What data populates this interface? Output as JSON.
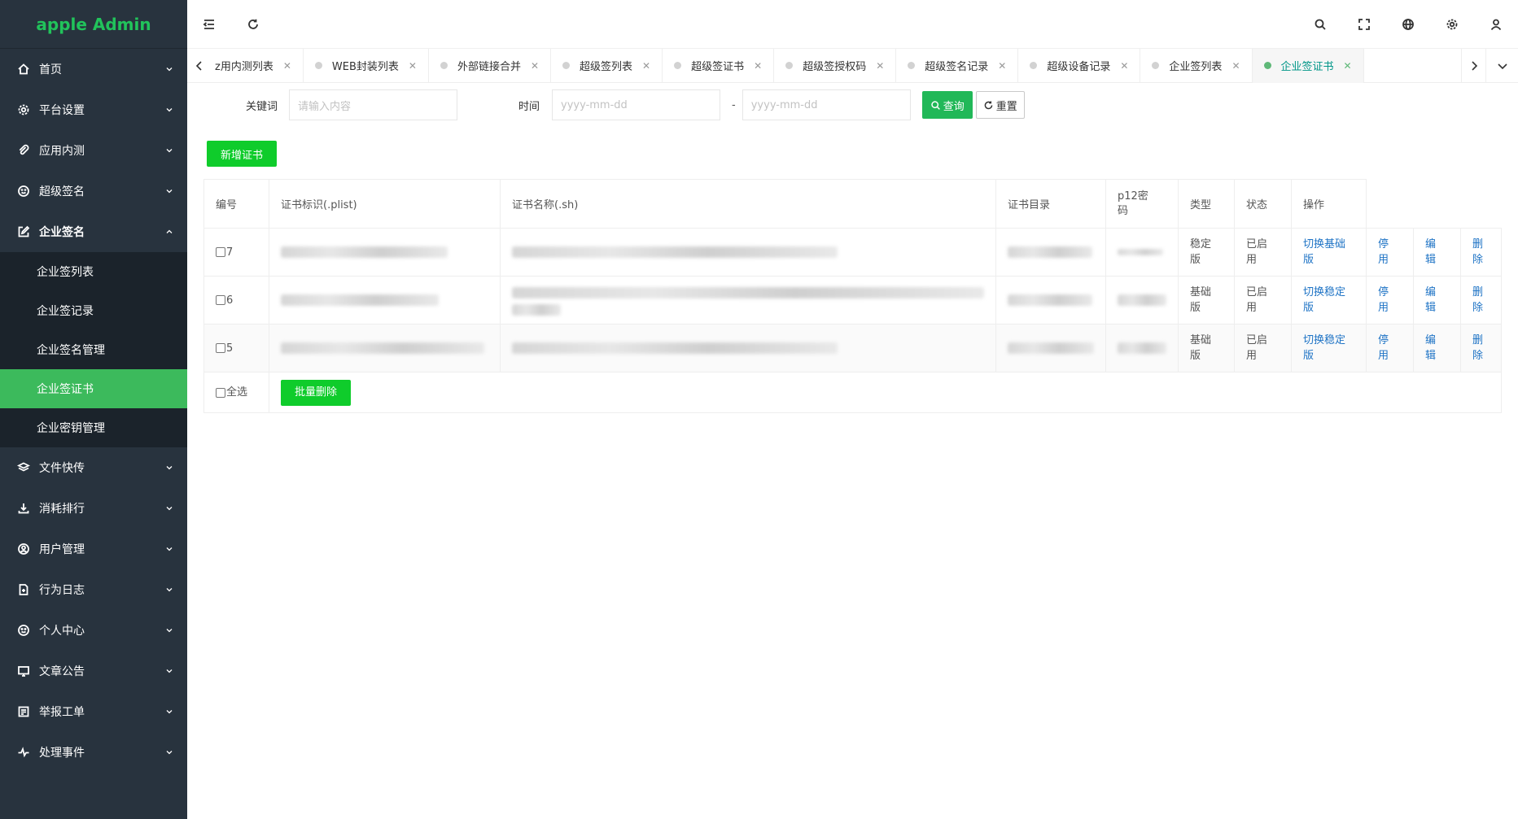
{
  "app": {
    "title": "apple Admin",
    "brand_color": "#21c35b",
    "accent": "#3cba5c"
  },
  "sidebar": {
    "items": [
      {
        "label": "首页",
        "icon": "home-icon"
      },
      {
        "label": "平台设置",
        "icon": "gear-icon"
      },
      {
        "label": "应用内测",
        "icon": "paperclip-icon"
      },
      {
        "label": "超级签名",
        "icon": "smile-icon"
      },
      {
        "label": "企业签名",
        "icon": "edit-icon",
        "open": true
      },
      {
        "label": "文件快传",
        "icon": "layers-icon"
      },
      {
        "label": "消耗排行",
        "icon": "download-icon"
      },
      {
        "label": "用户管理",
        "icon": "user-circle-icon"
      },
      {
        "label": "行为日志",
        "icon": "file-icon"
      },
      {
        "label": "个人中心",
        "icon": "face-icon"
      },
      {
        "label": "文章公告",
        "icon": "monitor-icon"
      },
      {
        "label": "举报工单",
        "icon": "report-icon"
      },
      {
        "label": "处理事件",
        "icon": "pulse-icon"
      }
    ],
    "submenu": [
      {
        "label": "企业签列表"
      },
      {
        "label": "企业签记录"
      },
      {
        "label": "企业签名管理"
      },
      {
        "label": "企业签证书",
        "active": true
      },
      {
        "label": "企业密钥管理"
      }
    ]
  },
  "header": {
    "icons": [
      "menu-fold-icon",
      "refresh-icon",
      "search-icon",
      "fullscreen-icon",
      "globe-icon",
      "settings-icon",
      "user-icon"
    ]
  },
  "tabs": [
    {
      "label": "z用内测列表",
      "dot": false
    },
    {
      "label": "WEB封装列表",
      "dot": true
    },
    {
      "label": "外部链接合并",
      "dot": true
    },
    {
      "label": "超级签列表",
      "dot": true
    },
    {
      "label": "超级签证书",
      "dot": true
    },
    {
      "label": "超级签授权码",
      "dot": true
    },
    {
      "label": "超级签名记录",
      "dot": true
    },
    {
      "label": "超级设备记录",
      "dot": true
    },
    {
      "label": "企业签列表",
      "dot": true
    },
    {
      "label": "企业签证书",
      "dot": true,
      "active": true
    }
  ],
  "search": {
    "keyword_label": "关键词",
    "keyword_placeholder": "请输入内容",
    "time_label": "时间",
    "date_from_placeholder": "yyyy-mm-dd",
    "date_separator": "-",
    "date_to_placeholder": "yyyy-mm-dd",
    "query_label": "查询",
    "reset_label": "重置"
  },
  "add_button": "新增证书",
  "table": {
    "headers": [
      "编号",
      "证书标识(.plist)",
      "证书名称(.sh)",
      "证书目录",
      "p12密码",
      "类型",
      "状态",
      "操作"
    ],
    "rows": [
      {
        "id": "7",
        "type": "稳定版",
        "status": "已启用",
        "switch": "切换基础版",
        "disable": "停用",
        "edit": "编辑",
        "delete": "删除"
      },
      {
        "id": "6",
        "type": "基础版",
        "status": "已启用",
        "switch": "切换稳定版",
        "disable": "停用",
        "edit": "编辑",
        "delete": "删除"
      },
      {
        "id": "5",
        "type": "基础版",
        "status": "已启用",
        "switch": "切换稳定版",
        "disable": "停用",
        "edit": "编辑",
        "delete": "删除"
      }
    ],
    "select_all": "全选",
    "batch_delete": "批量删除"
  }
}
